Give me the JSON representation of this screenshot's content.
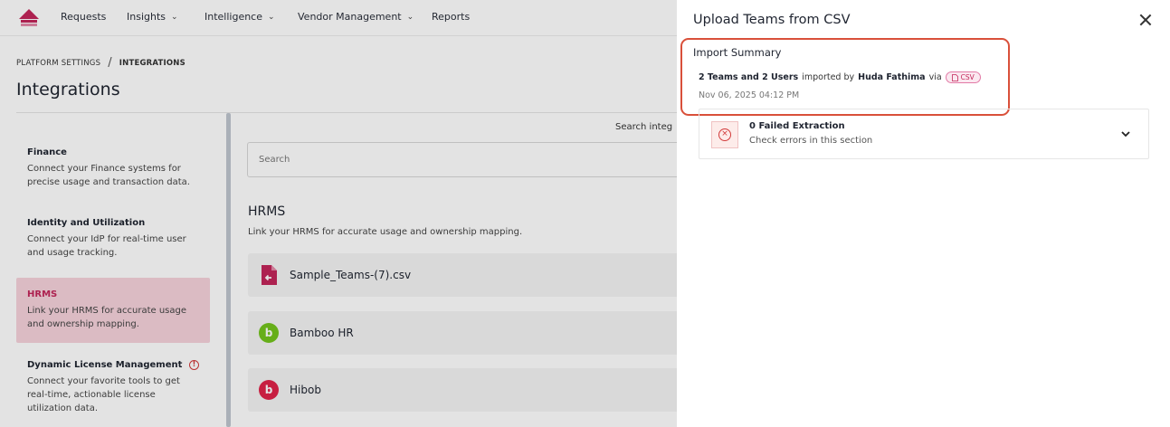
{
  "nav": {
    "items": [
      {
        "label": "Requests",
        "has_menu": false
      },
      {
        "label": "Insights",
        "has_menu": true
      },
      {
        "label": "Intelligence",
        "has_menu": true
      },
      {
        "label": "Vendor Management",
        "has_menu": true
      },
      {
        "label": "Reports",
        "has_menu": false
      }
    ],
    "brand_color": "#c3265a"
  },
  "breadcrumb": {
    "parent": "PLATFORM SETTINGS",
    "separator": "/",
    "current": "INTEGRATIONS"
  },
  "page_title": "Integrations",
  "sidebar": {
    "items": [
      {
        "title": "Finance",
        "desc": "Connect your Finance systems for precise usage and transaction data.",
        "active": false
      },
      {
        "title": "Identity and Utilization",
        "desc": "Connect your IdP for real-time user and usage tracking.",
        "active": false
      },
      {
        "title": "HRMS",
        "desc": "Link your HRMS for accurate usage and ownership mapping.",
        "active": true
      },
      {
        "title": "Dynamic License Management",
        "desc": "Connect your favorite tools to get real-time, actionable license utilization data.",
        "active": false,
        "warning_icon": "alert-circle-icon"
      }
    ]
  },
  "main": {
    "search_label": "Search integ",
    "search_placeholder": "Search",
    "section_title": "HRMS",
    "section_subtitle": "Link your HRMS for accurate usage and ownership mapping.",
    "integrations": [
      {
        "name": "Sample_Teams-(7).csv",
        "icon": "csv-file-icon",
        "icon_color": "#c3265a"
      },
      {
        "name": "Bamboo HR",
        "icon": "bamboohr-logo-icon",
        "icon_color": "#73c41d"
      },
      {
        "name": "Hibob",
        "icon": "hibob-logo-icon",
        "icon_color": "#e0234a"
      }
    ]
  },
  "drawer": {
    "title": "Upload Teams from CSV",
    "close_icon": "close-icon",
    "summary_label": "Import Summary",
    "summary": {
      "counts": "2 Teams and 2 Users",
      "imported_by_text": "imported by",
      "user": "Huda Fathima",
      "via_text": "via",
      "source_chip": "CSV",
      "date": "Nov 06, 2025 04:12 PM"
    },
    "failed": {
      "title": "0 Failed Extraction",
      "subtitle": "Check errors in this section",
      "icon": "error-circle-icon",
      "expand_icon": "chevron-down-icon"
    },
    "highlight_color": "#d9503a"
  }
}
